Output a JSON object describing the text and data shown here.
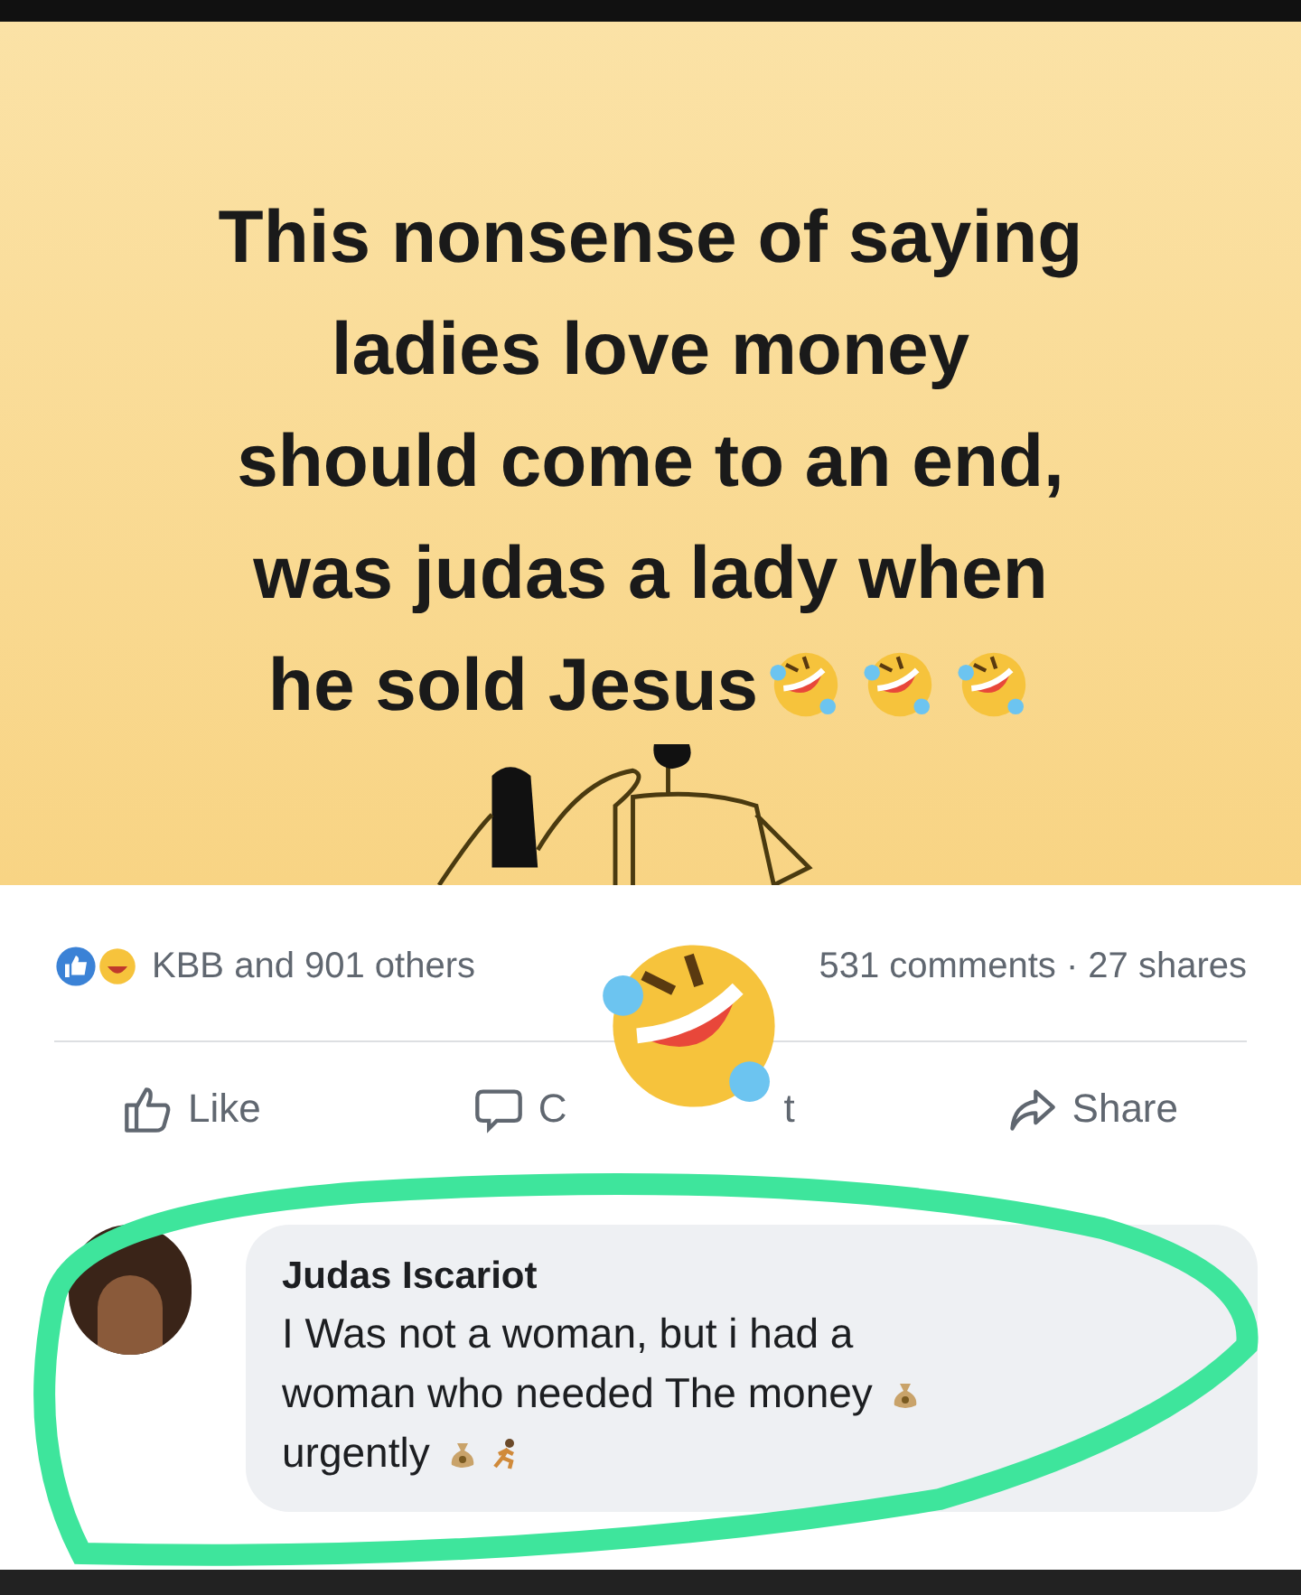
{
  "post_image": {
    "lines": [
      "This nonsense of saying",
      "ladies love money",
      "should come to an end,",
      "was judas a lady when",
      "he sold Jesus"
    ]
  },
  "reactions": {
    "summary": "KBB and 901 others",
    "counts": "531 comments · 27 shares"
  },
  "actions": [
    {
      "kind": "like",
      "label": "Like"
    },
    {
      "kind": "comment",
      "label_start": "C",
      "label_end": "t"
    },
    {
      "kind": "share",
      "label": "Share"
    }
  ],
  "comment": {
    "author": "Judas Iscariot",
    "lines": [
      {
        "kind": "plain",
        "text": "I Was not a woman, but i had a"
      },
      {
        "kind": "money",
        "text": "woman who needed The money"
      },
      {
        "kind": "money_runner",
        "text": "urgently"
      }
    ]
  }
}
